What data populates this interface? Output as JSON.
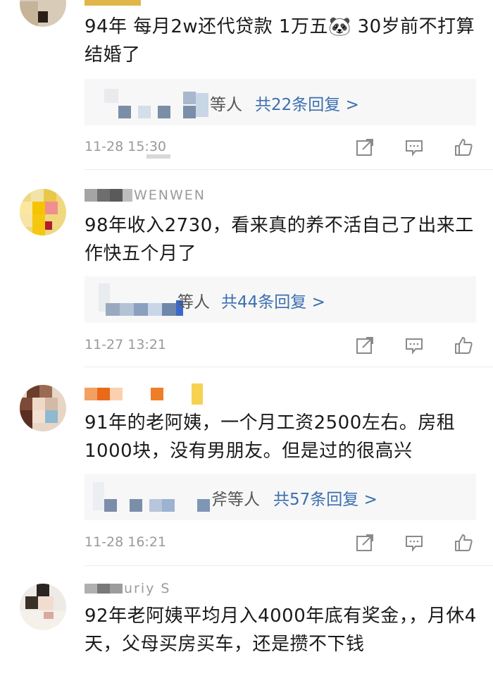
{
  "colors": {
    "reply_link": "#3b6fb0",
    "time": "#9a9a9a",
    "reply_bg": "#f7f7f7"
  },
  "comments": [
    {
      "username_tail": "",
      "text": "94年 每月2w还代贷款 1万五🐼 30岁前不打算结婚了",
      "reply_who": "等人",
      "reply_count": "共22条回复 >",
      "time": "11-28 15:30",
      "icons": [
        "share-icon",
        "comment-icon",
        "like-icon"
      ]
    },
    {
      "username_tail": "WENWEN",
      "text": "98年收入2730，看来真的养不活自己了出来工作快五个月了",
      "reply_who": "等人",
      "reply_count": "共44条回复 >",
      "time": "11-27 13:21",
      "icons": [
        "share-icon",
        "comment-icon",
        "like-icon"
      ]
    },
    {
      "username_tail": "",
      "text": "91年的老阿姨，一个月工资2500左右。房租1000块，没有男朋友。但是过的很高兴",
      "reply_who": "斧等人",
      "reply_count": "共57条回复 >",
      "time": "11-28 16:21",
      "icons": [
        "share-icon",
        "comment-icon",
        "like-icon"
      ]
    },
    {
      "username_tail": "uriy S",
      "text": "92年老阿姨平均月入4000年底有奖金，，月休4天，父母买房买车，还是攒不下钱"
    }
  ]
}
